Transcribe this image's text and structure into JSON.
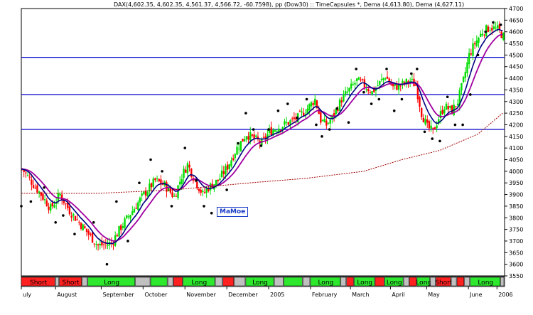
{
  "title": "DAX(4,602.35, 4,602.35, 4,561.37, 4,566.72, -60.7598), pp (Dow30) :: TimeCapsules *, Dema (4,613.80), Dema (4,627.11)",
  "watermark": "MaMoe",
  "chart_data": {
    "type": "line",
    "ylim": [
      3550,
      4700
    ],
    "y_ticks": [
      3550,
      3600,
      3650,
      3700,
      3750,
      3800,
      3850,
      3900,
      3950,
      4000,
      4050,
      4100,
      4150,
      4200,
      4250,
      4300,
      4350,
      4400,
      4450,
      4500,
      4550,
      4600,
      4650,
      4700
    ],
    "x_month_labels": [
      "uly",
      "August",
      "September",
      "October",
      "November",
      "December",
      "2005",
      "February",
      "March",
      "April",
      "May",
      "June",
      "2006"
    ],
    "horizontal_lines": [
      4490,
      4330,
      4180
    ],
    "colors": {
      "up_bar": "#00dd00",
      "down_bar": "#ff0000",
      "dema_fast": "#000080",
      "dema_slow": "#a000a0",
      "moving_avg": "#a00000",
      "hline": "#0000cc",
      "dots": "#000000"
    },
    "n_bars": 240,
    "close_anchors": [
      [
        0,
        4010
      ],
      [
        10,
        3900
      ],
      [
        15,
        3840
      ],
      [
        20,
        3900
      ],
      [
        25,
        3830
      ],
      [
        30,
        3780
      ],
      [
        35,
        3730
      ],
      [
        40,
        3680
      ],
      [
        47,
        3690
      ],
      [
        52,
        3760
      ],
      [
        58,
        3830
      ],
      [
        64,
        3900
      ],
      [
        70,
        3960
      ],
      [
        75,
        3940
      ],
      [
        80,
        3890
      ],
      [
        84,
        3980
      ],
      [
        87,
        4030
      ],
      [
        91,
        3960
      ],
      [
        95,
        3900
      ],
      [
        98,
        3930
      ],
      [
        103,
        3960
      ],
      [
        108,
        4020
      ],
      [
        113,
        4100
      ],
      [
        118,
        4160
      ],
      [
        122,
        4140
      ],
      [
        126,
        4120
      ],
      [
        130,
        4170
      ],
      [
        135,
        4190
      ],
      [
        140,
        4210
      ],
      [
        145,
        4230
      ],
      [
        150,
        4270
      ],
      [
        154,
        4310
      ],
      [
        157,
        4220
      ],
      [
        160,
        4200
      ],
      [
        163,
        4230
      ],
      [
        168,
        4310
      ],
      [
        172,
        4350
      ],
      [
        176,
        4390
      ],
      [
        180,
        4370
      ],
      [
        184,
        4340
      ],
      [
        188,
        4380
      ],
      [
        191,
        4410
      ],
      [
        195,
        4360
      ],
      [
        199,
        4370
      ],
      [
        204,
        4390
      ],
      [
        207,
        4370
      ],
      [
        210,
        4250
      ],
      [
        213,
        4190
      ],
      [
        216,
        4170
      ],
      [
        219,
        4230
      ],
      [
        222,
        4280
      ],
      [
        226,
        4260
      ],
      [
        229,
        4300
      ],
      [
        232,
        4390
      ],
      [
        235,
        4500
      ],
      [
        238,
        4550
      ],
      [
        242,
        4600
      ],
      [
        246,
        4620
      ],
      [
        250,
        4610
      ],
      [
        253,
        4580
      ]
    ],
    "ma_anchors": [
      [
        0,
        3905
      ],
      [
        40,
        3905
      ],
      [
        80,
        3920
      ],
      [
        120,
        3950
      ],
      [
        150,
        3970
      ],
      [
        180,
        4000
      ],
      [
        200,
        4050
      ],
      [
        220,
        4090
      ],
      [
        240,
        4160
      ],
      [
        253,
        4250
      ]
    ],
    "dots": [
      [
        0,
        3850
      ],
      [
        5,
        3870
      ],
      [
        12,
        3930
      ],
      [
        18,
        3780
      ],
      [
        22,
        3810
      ],
      [
        28,
        3730
      ],
      [
        38,
        3780
      ],
      [
        45,
        3600
      ],
      [
        50,
        3870
      ],
      [
        56,
        3700
      ],
      [
        62,
        3950
      ],
      [
        68,
        4050
      ],
      [
        74,
        4000
      ],
      [
        79,
        3850
      ],
      [
        86,
        4100
      ],
      [
        92,
        3960
      ],
      [
        96,
        3850
      ],
      [
        100,
        3820
      ],
      [
        108,
        3920
      ],
      [
        114,
        4120
      ],
      [
        118,
        4250
      ],
      [
        122,
        4180
      ],
      [
        126,
        4110
      ],
      [
        130,
        4180
      ],
      [
        135,
        4260
      ],
      [
        140,
        4290
      ],
      [
        145,
        4230
      ],
      [
        150,
        4310
      ],
      [
        155,
        4200
      ],
      [
        158,
        4150
      ],
      [
        162,
        4180
      ],
      [
        166,
        4270
      ],
      [
        172,
        4210
      ],
      [
        176,
        4440
      ],
      [
        180,
        4340
      ],
      [
        184,
        4290
      ],
      [
        188,
        4310
      ],
      [
        192,
        4440
      ],
      [
        196,
        4260
      ],
      [
        200,
        4310
      ],
      [
        205,
        4420
      ],
      [
        208,
        4440
      ],
      [
        212,
        4170
      ],
      [
        216,
        4140
      ],
      [
        220,
        4130
      ],
      [
        224,
        4320
      ],
      [
        228,
        4200
      ],
      [
        232,
        4200
      ],
      [
        236,
        4330
      ],
      [
        240,
        4500
      ],
      [
        244,
        4600
      ],
      [
        248,
        4640
      ],
      [
        252,
        4630
      ]
    ],
    "signals": [
      {
        "label": "Short",
        "from": 0,
        "to": 18,
        "color": "#ff2020"
      },
      {
        "label": "",
        "from": 18,
        "to": 20,
        "color": "#c0c0c0"
      },
      {
        "label": "Short",
        "from": 20,
        "to": 32,
        "color": "#ff2020"
      },
      {
        "label": "",
        "from": 32,
        "to": 35,
        "color": "#c0c0c0"
      },
      {
        "label": "Long",
        "from": 35,
        "to": 60,
        "color": "#2ee82e"
      },
      {
        "label": "",
        "from": 60,
        "to": 68,
        "color": "#c0c0c0"
      },
      {
        "label": "",
        "from": 68,
        "to": 77,
        "color": "#2ee82e"
      },
      {
        "label": "",
        "from": 77,
        "to": 80,
        "color": "#c0c0c0"
      },
      {
        "label": "",
        "from": 80,
        "to": 85,
        "color": "#ff2020"
      },
      {
        "label": "Long",
        "from": 85,
        "to": 102,
        "color": "#2ee82e"
      },
      {
        "label": "",
        "from": 102,
        "to": 106,
        "color": "#c0c0c0"
      },
      {
        "label": "",
        "from": 106,
        "to": 112,
        "color": "#ff2020"
      },
      {
        "label": "",
        "from": 112,
        "to": 118,
        "color": "#c0c0c0"
      },
      {
        "label": "Long",
        "from": 118,
        "to": 133,
        "color": "#2ee82e"
      },
      {
        "label": "",
        "from": 133,
        "to": 138,
        "color": "#c0c0c0"
      },
      {
        "label": "",
        "from": 138,
        "to": 148,
        "color": "#2ee82e"
      },
      {
        "label": "",
        "from": 148,
        "to": 152,
        "color": "#c0c0c0"
      },
      {
        "label": "Long",
        "from": 152,
        "to": 168,
        "color": "#2ee82e"
      },
      {
        "label": "",
        "from": 168,
        "to": 171,
        "color": "#c0c0c0"
      },
      {
        "label": "",
        "from": 171,
        "to": 175,
        "color": "#ff2020"
      },
      {
        "label": "Long",
        "from": 175,
        "to": 186,
        "color": "#2ee82e"
      },
      {
        "label": "",
        "from": 186,
        "to": 191,
        "color": "#ff2020"
      },
      {
        "label": "Long",
        "from": 191,
        "to": 201,
        "color": "#2ee82e"
      },
      {
        "label": "",
        "from": 201,
        "to": 204,
        "color": "#c0c0c0"
      },
      {
        "label": "",
        "from": 204,
        "to": 208,
        "color": "#ff2020"
      },
      {
        "label": "Long",
        "from": 208,
        "to": 215,
        "color": "#2ee82e"
      },
      {
        "label": "",
        "from": 215,
        "to": 218,
        "color": "#c0c0c0"
      },
      {
        "label": "Short",
        "from": 218,
        "to": 226,
        "color": "#ff2020"
      },
      {
        "label": "",
        "from": 226,
        "to": 229,
        "color": "#c0c0c0"
      },
      {
        "label": "",
        "from": 229,
        "to": 233,
        "color": "#ff2020"
      },
      {
        "label": "",
        "from": 233,
        "to": 236,
        "color": "#c0c0c0"
      },
      {
        "label": "Long",
        "from": 236,
        "to": 252,
        "color": "#2ee82e"
      },
      {
        "label": "",
        "from": 252,
        "to": 254,
        "color": "#c0c0c0"
      }
    ]
  }
}
